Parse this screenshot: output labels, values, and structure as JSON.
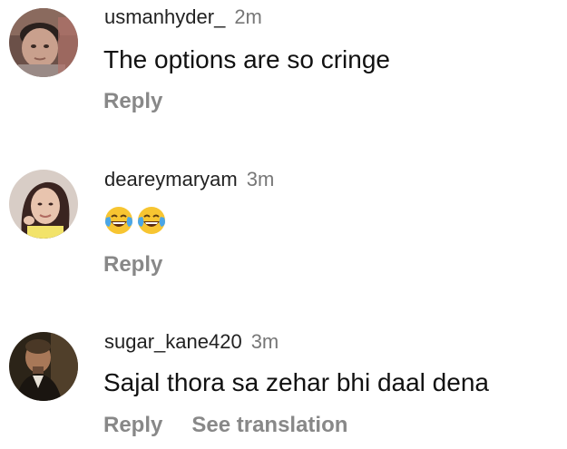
{
  "comments": [
    {
      "username": "usmanhyder_",
      "time": "2m",
      "text": "The options are so cringe",
      "reply_label": "Reply",
      "avatar_icon": "child-photo-avatar"
    },
    {
      "username": "dearеymaryam",
      "time": "3m",
      "emojis": [
        "😂",
        "😂"
      ],
      "reply_label": "Reply",
      "avatar_icon": "woman-photo-avatar"
    },
    {
      "username": "sugar_kane420",
      "time": "3m",
      "text": "Sajal thora sa zehar bhi daal dena",
      "reply_label": "Reply",
      "translate_label": "See translation",
      "avatar_icon": "man-photo-avatar"
    }
  ],
  "colors": {
    "username": "#222222",
    "time": "#777777",
    "action": "#888888",
    "text": "#111111"
  }
}
